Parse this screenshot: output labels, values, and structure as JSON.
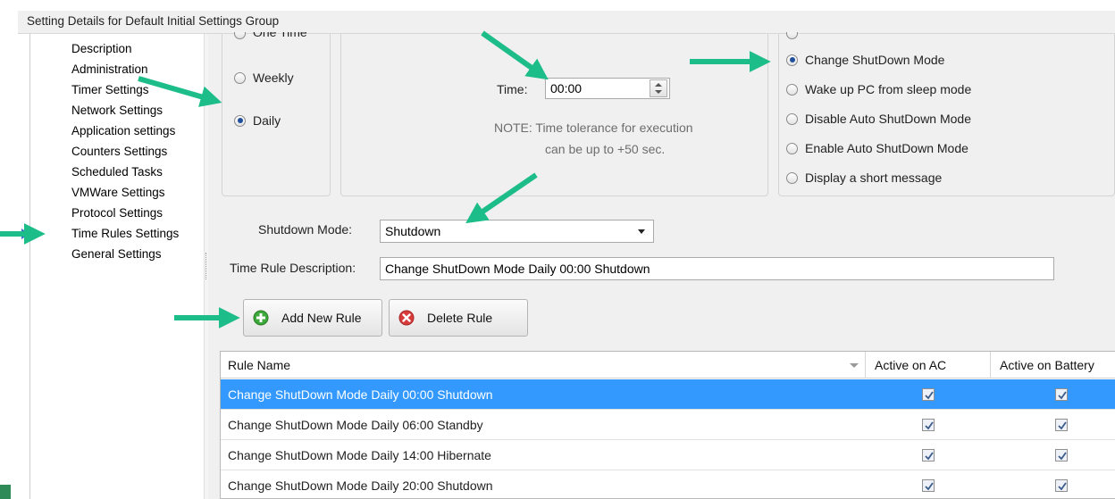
{
  "window": {
    "title": "Setting Details for Default Initial Settings Group"
  },
  "sidebar": {
    "items": [
      {
        "label": "Description"
      },
      {
        "label": "Administration"
      },
      {
        "label": "Timer Settings"
      },
      {
        "label": "Network Settings"
      },
      {
        "label": "Application settings"
      },
      {
        "label": "Counters Settings"
      },
      {
        "label": "Scheduled Tasks"
      },
      {
        "label": "VMWare Settings"
      },
      {
        "label": "Protocol Settings"
      },
      {
        "label": "Time Rules Settings",
        "selected": true
      },
      {
        "label": "General Settings"
      }
    ],
    "selected_marker_icon": "triangle-right-icon"
  },
  "frequency": {
    "options": [
      {
        "label": "One Time",
        "selected": false
      },
      {
        "label": "Weekly",
        "selected": false
      },
      {
        "label": "Daily",
        "selected": true
      }
    ]
  },
  "time": {
    "label": "Time:",
    "value": "00:00",
    "note_line1": "NOTE: Time tolerance  for execution",
    "note_line2": "can be up to +50 sec."
  },
  "action": {
    "options": [
      {
        "label": "Change ShutDown Mode",
        "selected": true
      },
      {
        "label": "Wake up PC from sleep mode",
        "selected": false
      },
      {
        "label": "Disable Auto ShutDown Mode",
        "selected": false
      },
      {
        "label": "Enable Auto ShutDown Mode",
        "selected": false
      },
      {
        "label": "Display a short message",
        "selected": false
      }
    ]
  },
  "shutdown_mode": {
    "label": "Shutdown Mode:",
    "value": "Shutdown"
  },
  "rule_description": {
    "label": "Time Rule Description:",
    "value": "Change ShutDown Mode Daily  00:00  Shutdown"
  },
  "toolbar": {
    "add_label": "Add New Rule",
    "delete_label": "Delete Rule"
  },
  "rules_table": {
    "columns": [
      "Rule Name",
      "Active on AC",
      "Active on Battery"
    ],
    "rows": [
      {
        "name": "Change ShutDown Mode Daily  00:00  Shutdown",
        "ac": true,
        "battery": true,
        "selected": true
      },
      {
        "name": "Change ShutDown Mode Daily  06:00  Standby",
        "ac": true,
        "battery": true,
        "selected": false
      },
      {
        "name": "Change ShutDown Mode Daily  14:00  Hibernate",
        "ac": true,
        "battery": true,
        "selected": false
      },
      {
        "name": "Change ShutDown Mode Daily  20:00  Shutdown",
        "ac": true,
        "battery": true,
        "selected": false
      }
    ]
  },
  "colors": {
    "annotation_arrow": "#1dbd8a",
    "selection": "#3399ff",
    "add_icon": "#3ea83a",
    "delete_icon": "#d93b3b"
  }
}
